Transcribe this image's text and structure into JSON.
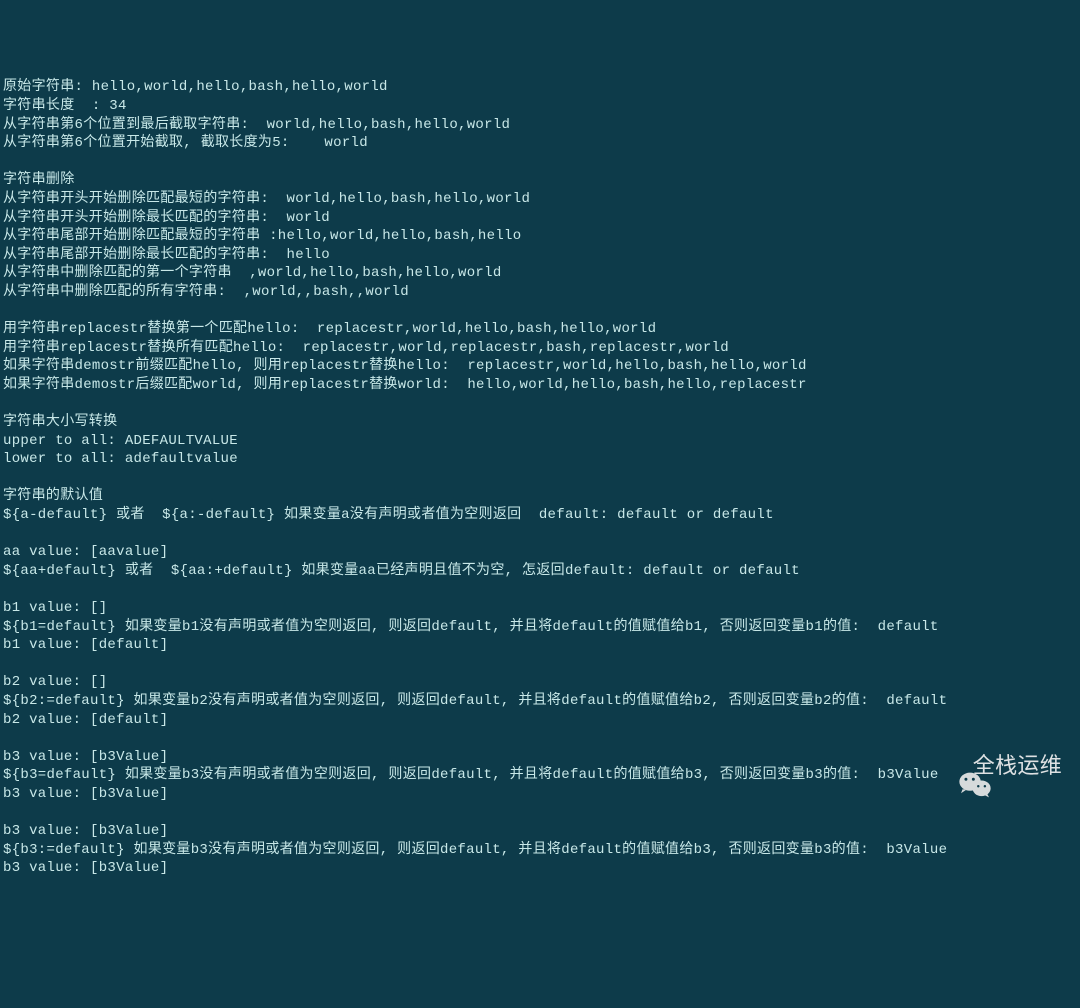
{
  "terminal": {
    "lines": [
      "原始字符串: hello,world,hello,bash,hello,world",
      "字符串长度  : 34",
      "从字符串第6个位置到最后截取字符串:  world,hello,bash,hello,world",
      "从字符串第6个位置开始截取, 截取长度为5:    world",
      "",
      "字符串删除",
      "从字符串开头开始删除匹配最短的字符串:  world,hello,bash,hello,world",
      "从字符串开头开始删除最长匹配的字符串:  world",
      "从字符串尾部开始删除匹配最短的字符串 :hello,world,hello,bash,hello",
      "从字符串尾部开始删除最长匹配的字符串:  hello",
      "从字符串中删除匹配的第一个字符串  ,world,hello,bash,hello,world",
      "从字符串中删除匹配的所有字符串:  ,world,,bash,,world",
      "",
      "用字符串replacestr替换第一个匹配hello:  replacestr,world,hello,bash,hello,world",
      "用字符串replacestr替换所有匹配hello:  replacestr,world,replacestr,bash,replacestr,world",
      "如果字符串demostr前缀匹配hello, 则用replacestr替换hello:  replacestr,world,hello,bash,hello,world",
      "如果字符串demostr后缀匹配world, 则用replacestr替换world:  hello,world,hello,bash,hello,replacestr",
      "",
      "字符串大小写转换",
      "upper to all: ADEFAULTVALUE",
      "lower to all: adefaultvalue",
      "",
      "字符串的默认值",
      "${a-default} 或者  ${a:-default} 如果变量a没有声明或者值为空则返回  default: default or default",
      "",
      "aa value: [aavalue]",
      "${aa+default} 或者  ${aa:+default} 如果变量aa已经声明且值不为空, 怎返回default: default or default",
      "",
      "b1 value: []",
      "${b1=default} 如果变量b1没有声明或者值为空则返回, 则返回default, 并且将default的值赋值给b1, 否则返回变量b1的值:  default",
      "b1 value: [default]",
      "",
      "b2 value: []",
      "${b2:=default} 如果变量b2没有声明或者值为空则返回, 则返回default, 并且将default的值赋值给b2, 否则返回变量b2的值:  default",
      "b2 value: [default]",
      "",
      "b3 value: [b3Value]",
      "${b3=default} 如果变量b3没有声明或者值为空则返回, 则返回default, 并且将default的值赋值给b3, 否则返回变量b3的值:  b3Value",
      "b3 value: [b3Value]",
      "",
      "b3 value: [b3Value]",
      "${b3:=default} 如果变量b3没有声明或者值为空则返回, 则返回default, 并且将default的值赋值给b3, 否则返回变量b3的值:  b3Value",
      "b3 value: [b3Value]"
    ]
  },
  "watermark": {
    "text": "全栈运维"
  }
}
